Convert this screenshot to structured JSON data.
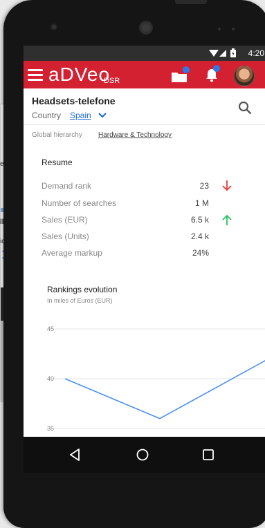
{
  "background_card": {
    "texts": [
      "el I",
      "llp",
      "ida",
      "1"
    ]
  },
  "status_bar": {
    "time": "4:20",
    "icons": [
      "wifi-icon",
      "signal-icon",
      "battery-icon"
    ]
  },
  "app_bar": {
    "brand": "aDVeo",
    "brand_sub": "DSR",
    "brand_color": "#d42132",
    "notification_dot_color": "#2d7be6"
  },
  "header": {
    "product_title": "Headsets-telefone",
    "country_label": "Country",
    "country_value": "Spain"
  },
  "hierarchy": {
    "label": "Global hierarchy",
    "link": "Hardware & Technology"
  },
  "resume": {
    "title": "Resume",
    "rows": [
      {
        "label": "Demand rank",
        "value": "23",
        "trend": "down"
      },
      {
        "label": "Number of searches",
        "value": "1 M",
        "trend": ""
      },
      {
        "label": "Sales (EUR)",
        "value": "6.5 k",
        "trend": "up"
      },
      {
        "label": "Sales (Units)",
        "value": "2.4 k",
        "trend": ""
      },
      {
        "label": "Average markup",
        "value": "24%",
        "trend": ""
      }
    ],
    "trend_colors": {
      "down": "#e53935",
      "up": "#22c55e"
    }
  },
  "chart": {
    "title": "Rankings evolution",
    "subtitle": "In miles of Euros (EUR)"
  },
  "chart_data": {
    "type": "line",
    "title": "Rankings evolution",
    "subtitle": "In miles of Euros (EUR)",
    "y_ticks": [
      "45",
      "40",
      "35"
    ],
    "ylim": [
      35,
      45
    ],
    "series": [
      {
        "values": [
          40,
          36,
          42
        ],
        "color": "#4a8ff0"
      }
    ],
    "grid": true
  },
  "nav_bar": {
    "buttons": [
      "back-icon",
      "home-icon",
      "recents-icon"
    ]
  }
}
